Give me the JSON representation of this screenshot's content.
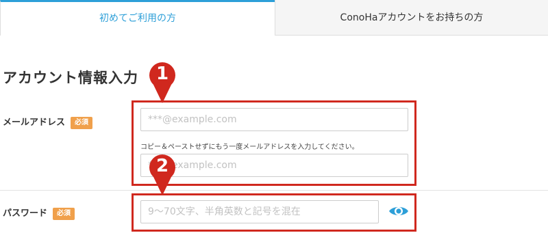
{
  "tabs": [
    {
      "label": "初めてご利用の方",
      "active": true
    },
    {
      "label": "ConoHaアカウントをお持ちの方",
      "active": false
    }
  ],
  "section_title": "アカウント情報入力",
  "email": {
    "label": "メールアドレス",
    "required_badge": "必須",
    "placeholder": "***@example.com",
    "confirm_hint": "コピー＆ペーストせずにもう一度メールアドレスを入力してください。",
    "confirm_placeholder": "***@example.com"
  },
  "password": {
    "label": "パスワード",
    "required_badge": "必須",
    "placeholder": "9〜70文字、半角英数と記号を混在",
    "toggle_icon": "eye-icon"
  },
  "callouts": [
    {
      "number": "1"
    },
    {
      "number": "2"
    }
  ],
  "colors": {
    "accent": "#2d9fd8",
    "badge": "#f0a04b",
    "callout": "#d0281e"
  }
}
